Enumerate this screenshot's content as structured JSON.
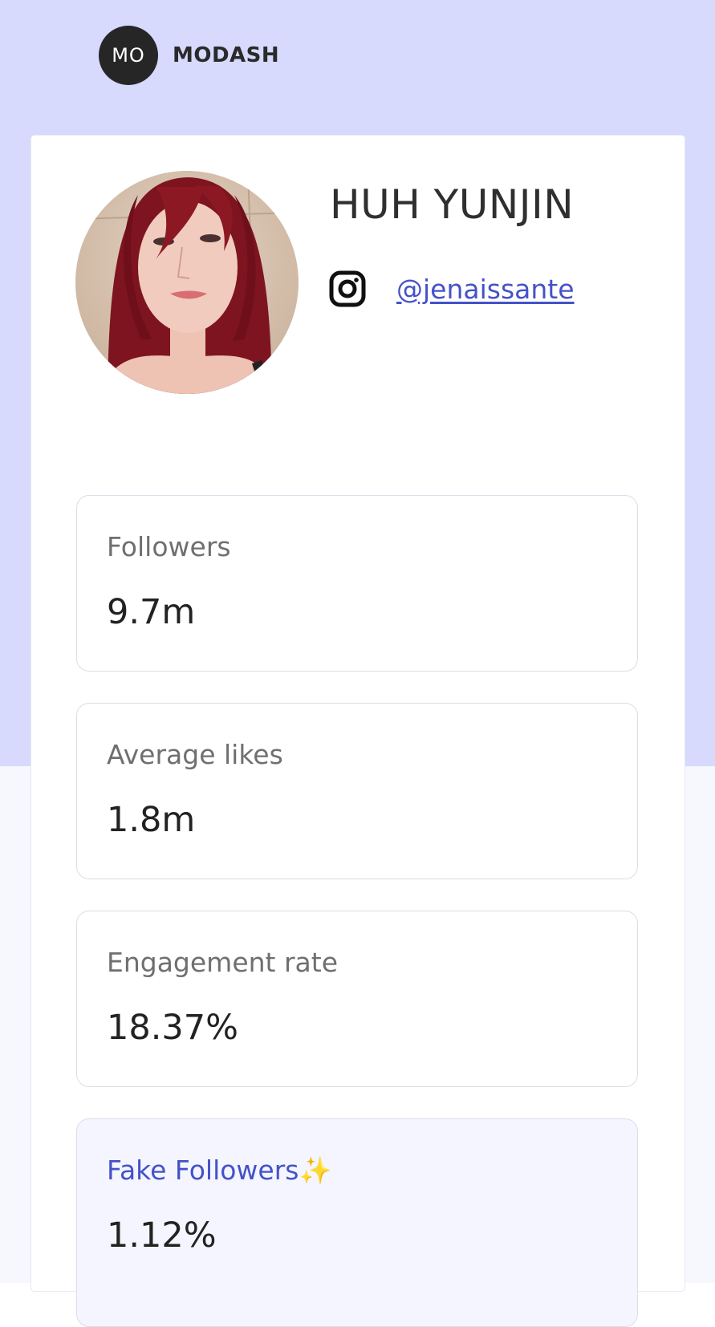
{
  "brand": {
    "logo_text": "MO",
    "name": "MODASH"
  },
  "profile": {
    "name": "HUH YUNJIN",
    "platform_icon": "instagram-icon",
    "handle": "@jenaissante"
  },
  "stats": [
    {
      "label": "Followers",
      "value": "9.7m"
    },
    {
      "label": "Average likes",
      "value": "1.8m"
    },
    {
      "label": "Engagement rate",
      "value": "18.37%"
    },
    {
      "label": "Fake Followers✨",
      "value": "1.12%"
    }
  ],
  "colors": {
    "header_background": "#d7d9fd",
    "accent": "#4452c8",
    "logo_background": "#262626"
  }
}
